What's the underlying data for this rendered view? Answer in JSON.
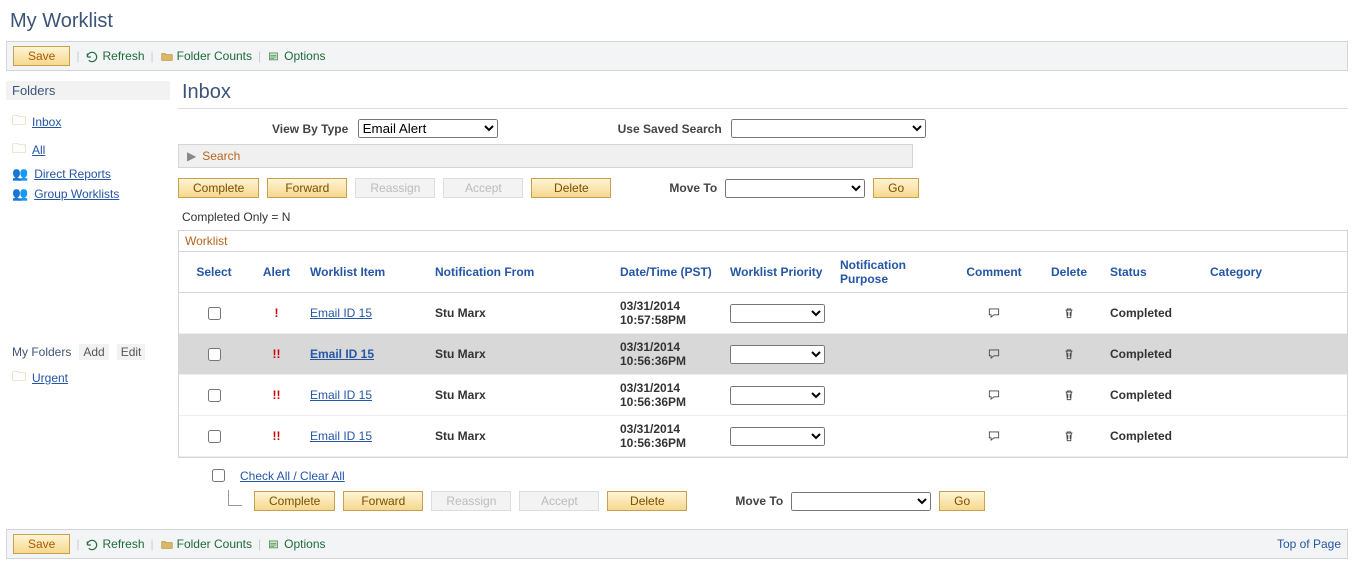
{
  "page": {
    "title": "My Worklist"
  },
  "toolbarTop": {
    "save": "Save",
    "refresh": "Refresh",
    "folderCounts": "Folder Counts",
    "options": "Options"
  },
  "sidebar": {
    "foldersHeader": "Folders",
    "items": [
      {
        "label": "Inbox",
        "iconType": "folder"
      },
      {
        "label": "All",
        "iconType": "folder"
      },
      {
        "label": "Direct Reports",
        "iconType": "group"
      },
      {
        "label": "Group Worklists",
        "iconType": "group"
      }
    ],
    "myFoldersLabel": "My Folders",
    "addLabel": "Add",
    "editLabel": "Edit",
    "userFolders": [
      {
        "label": "Urgent",
        "iconType": "folder"
      }
    ]
  },
  "main": {
    "heading": "Inbox",
    "viewByTypeLabel": "View By Type",
    "viewByTypeValue": "Email Alert",
    "useSavedSearchLabel": "Use Saved Search",
    "searchLabel": "Search",
    "buttons": {
      "complete": "Complete",
      "forward": "Forward",
      "reassign": "Reassign",
      "accept": "Accept",
      "delete": "Delete",
      "go": "Go",
      "moveToLabel": "Move To"
    },
    "statusText": "Completed Only = N",
    "worklistCaption": "Worklist",
    "columns": {
      "select": "Select",
      "alert": "Alert",
      "worklistItem": "Worklist Item",
      "notificationFrom": "Notification From",
      "dateTime": "Date/Time (PST)",
      "worklistPriority": "Worklist Priority",
      "notificationPurpose": "Notification Purpose",
      "comment": "Comment",
      "delete": "Delete",
      "status": "Status",
      "category": "Category"
    },
    "rows": [
      {
        "alert": "!",
        "item": "Email ID 15",
        "from": "Stu Marx",
        "date": "03/31/2014 10:57:58PM",
        "status": "Completed",
        "selected": false
      },
      {
        "alert": "!!",
        "item": "Email ID 15",
        "from": "Stu Marx",
        "date": "03/31/2014 10:56:36PM",
        "status": "Completed",
        "selected": true
      },
      {
        "alert": "!!",
        "item": "Email ID 15",
        "from": "Stu Marx",
        "date": "03/31/2014 10:56:36PM",
        "status": "Completed",
        "selected": false
      },
      {
        "alert": "!!",
        "item": "Email ID 15",
        "from": "Stu Marx",
        "date": "03/31/2014 10:56:36PM",
        "status": "Completed",
        "selected": false
      }
    ],
    "checkAllLabel": "Check All / Clear All",
    "topOfPage": "Top of Page"
  }
}
